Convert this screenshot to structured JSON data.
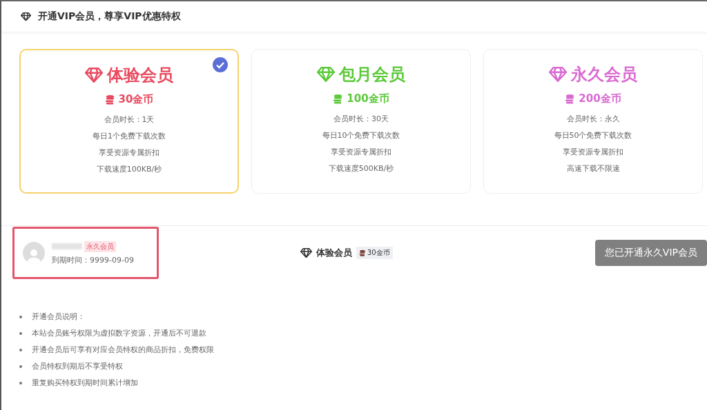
{
  "header": {
    "title": "开通VIP会员，尊享VIP优惠特权"
  },
  "plans": [
    {
      "name": "体验会员",
      "price": "30金币",
      "color": "#e84a5f",
      "selected": true,
      "features": [
        "会员时长：1天",
        "每日1个免费下载次数",
        "享受资源专属折扣",
        "下载速度100KB/秒"
      ]
    },
    {
      "name": "包月会员",
      "price": "100金币",
      "color": "#5cc93a",
      "selected": false,
      "features": [
        "会员时长：30天",
        "每日10个免费下载次数",
        "享受资源专属折扣",
        "下载速度500KB/秒"
      ]
    },
    {
      "name": "永久会员",
      "price": "200金币",
      "color": "#d96ad0",
      "selected": false,
      "features": [
        "会员时长：永久",
        "每日50个免费下载次数",
        "享受资源专属折扣",
        "高速下载不限速"
      ]
    }
  ],
  "user": {
    "badge": "永久会员",
    "expiry": "到期时间：9999-09-09"
  },
  "order": {
    "plan": "体验会员",
    "price": "30金币"
  },
  "action_button": {
    "label": "您已开通永久VIP会员",
    "disabled": true
  },
  "notes": [
    "开通会员说明：",
    "本站会员账号权限为虚拟数字资源，开通后不可退款",
    "开通会员后可享有对应会员特权的商品折扣，免费权限",
    "会员特权到期后不享受特权",
    "重复购买特权到期时间累计增加"
  ]
}
